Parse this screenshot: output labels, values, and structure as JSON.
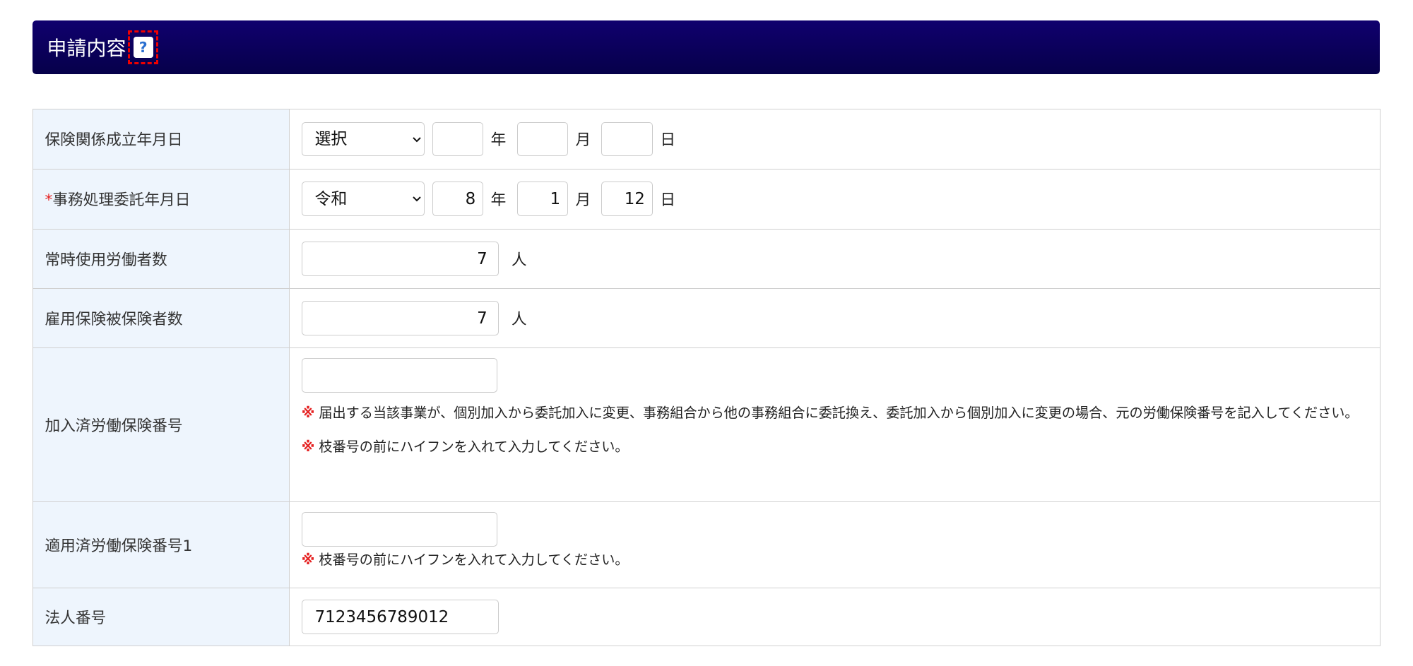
{
  "section": {
    "title": "申請内容",
    "help_icon": "?"
  },
  "rows": {
    "r1": {
      "label": "保険関係成立年月日",
      "era": "選択",
      "year": "",
      "month": "",
      "day": ""
    },
    "r2": {
      "required_mark": "*",
      "label": "事務処理委託年月日",
      "era": "令和",
      "year": "8",
      "month": "1",
      "day": "12"
    },
    "r3": {
      "label": "常時使用労働者数",
      "value": "7",
      "unit": "人"
    },
    "r4": {
      "label": "雇用保険被保険者数",
      "value": "7",
      "unit": "人"
    },
    "r5": {
      "label": "加入済労働保険番号",
      "value": "",
      "note_mark": "※",
      "note1": "届出する当該事業が、個別加入から委託加入に変更、事務組合から他の事務組合に委託換え、委託加入から個別加入に変更の場合、元の労働保険番号を記入してください。",
      "note2": "枝番号の前にハイフンを入れて入力してください。"
    },
    "r6": {
      "label": "適用済労働保険番号1",
      "value": "",
      "note_mark": "※",
      "note": "枝番号の前にハイフンを入れて入力してください。"
    },
    "r7": {
      "label": "法人番号",
      "value": "7123456789012"
    }
  },
  "units": {
    "year": "年",
    "month": "月",
    "day": "日"
  }
}
